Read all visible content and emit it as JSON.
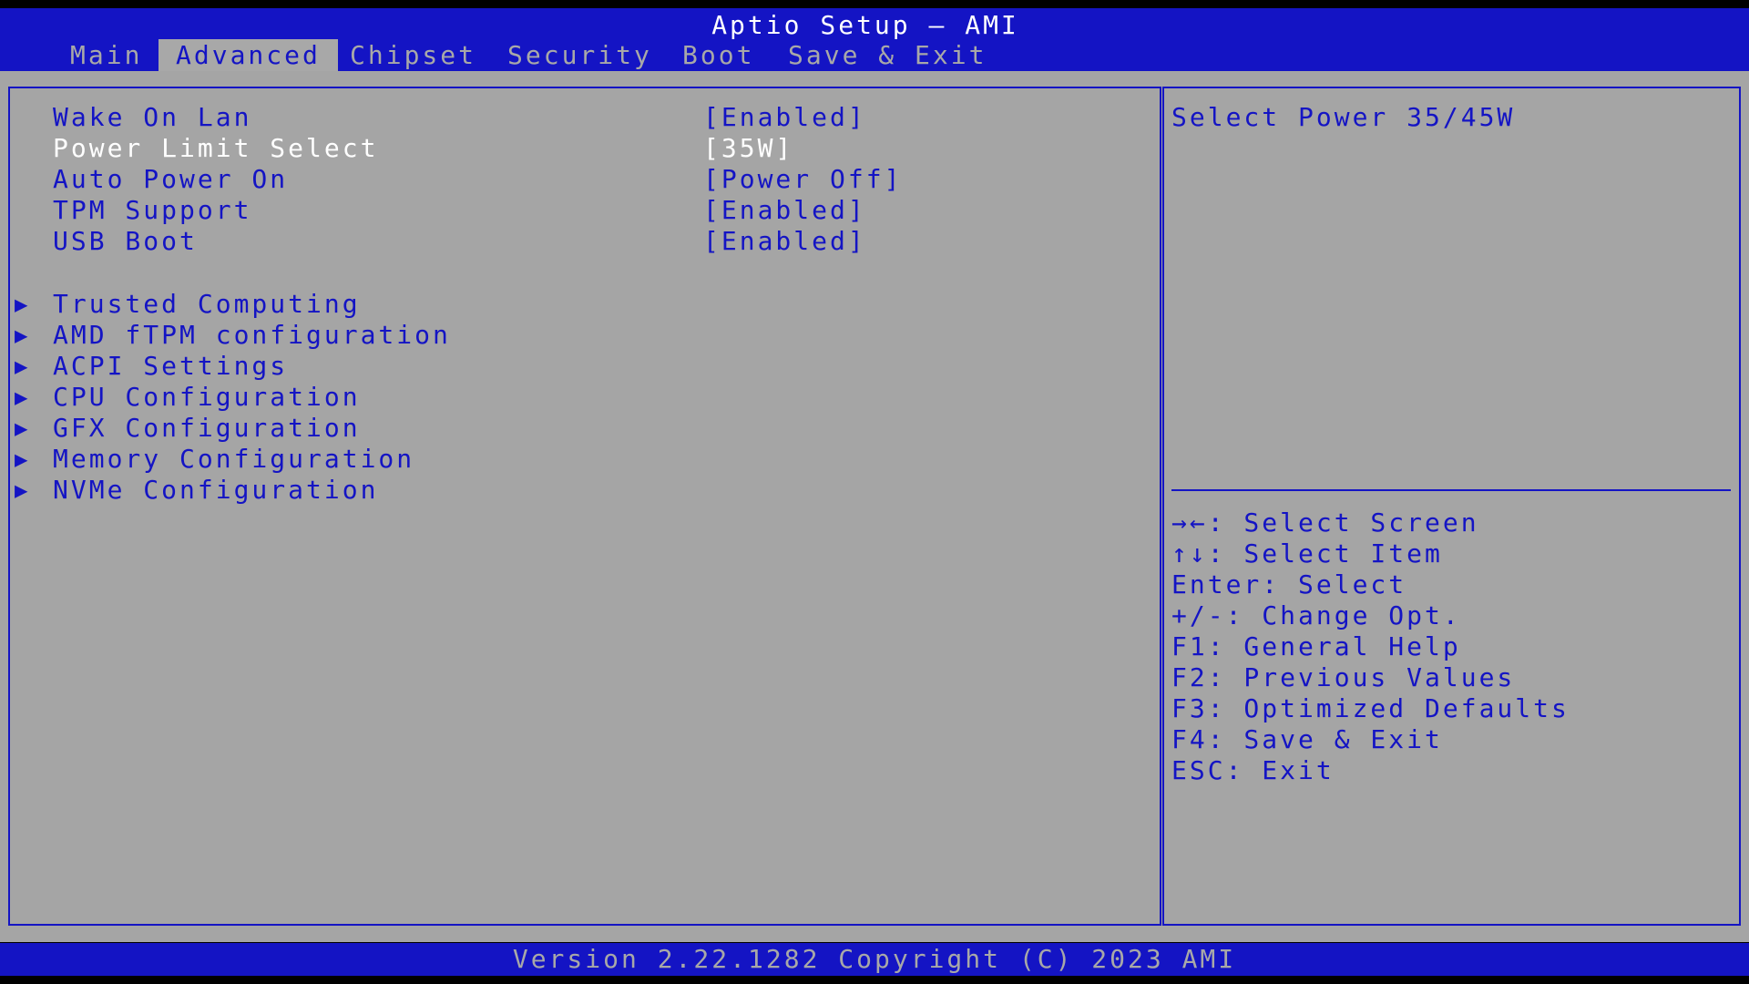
{
  "header": {
    "title": "Aptio Setup – AMI",
    "tabs": [
      "Main",
      "Advanced",
      "Chipset",
      "Security",
      "Boot",
      "Save & Exit"
    ],
    "active_tab": "Advanced"
  },
  "settings": [
    {
      "label": "Wake On Lan",
      "value": "[Enabled]"
    },
    {
      "label": "Power Limit Select",
      "value": "[35W]",
      "selected": true
    },
    {
      "label": "Auto Power On",
      "value": "[Power Off]"
    },
    {
      "label": "TPM Support",
      "value": "[Enabled]"
    },
    {
      "label": "USB Boot",
      "value": "[Enabled]"
    }
  ],
  "submenus": [
    {
      "arrow": "▶",
      "label": "Trusted Computing"
    },
    {
      "arrow": "▶",
      "label": "AMD fTPM configuration"
    },
    {
      "arrow": "▶",
      "label": "ACPI Settings"
    },
    {
      "arrow": "▶",
      "label": "CPU Configuration"
    },
    {
      "arrow": "▶",
      "label": "GFX Configuration"
    },
    {
      "arrow": "▶",
      "label": "Memory Configuration"
    },
    {
      "arrow": "▶",
      "label": "NVMe Configuration"
    }
  ],
  "help": {
    "text": "Select Power 35/45W"
  },
  "key_hints": [
    "→←: Select Screen",
    "↑↓: Select Item",
    "Enter: Select",
    "+/-: Change Opt.",
    "F1: General Help",
    "F2: Previous Values",
    "F3: Optimized Defaults",
    "F4: Save & Exit",
    "ESC: Exit"
  ],
  "footer": {
    "version": "Version 2.22.1282 Copyright (C) 2023 AMI"
  },
  "colors": {
    "bar_blue": "#1414c4",
    "panel_gray": "#a5a5a5",
    "tab_gray": "#a8a8a8",
    "highlight_white": "#ffffff"
  }
}
